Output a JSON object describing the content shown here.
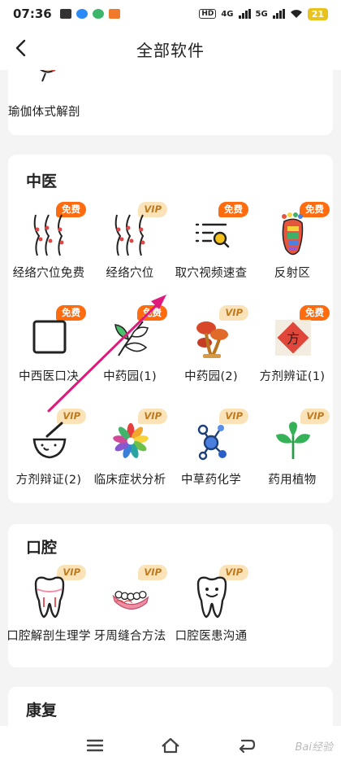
{
  "status": {
    "time": "07:36",
    "hd": "HD",
    "net1": "4G",
    "net2": "5G",
    "battery": "21"
  },
  "header": {
    "title": "全部软件"
  },
  "partial_item": {
    "label": "瑜伽体式解剖"
  },
  "sections": [
    {
      "title": "中医",
      "apps": [
        {
          "label": "经络穴位免费",
          "badge": "免费"
        },
        {
          "label": "经络穴位",
          "badge": "VIP"
        },
        {
          "label": "取穴视频速查",
          "badge": "免费"
        },
        {
          "label": "反射区",
          "badge": "免费"
        },
        {
          "label": "中西医口决",
          "badge": "免费"
        },
        {
          "label": "中药园(1)",
          "badge": "免费"
        },
        {
          "label": "中药园(2)",
          "badge": "VIP"
        },
        {
          "label": "方剂辨证(1)",
          "badge": "免费"
        },
        {
          "label": "方剂辩证(2)",
          "badge": "VIP"
        },
        {
          "label": "临床症状分析",
          "badge": "VIP"
        },
        {
          "label": "中草药化学",
          "badge": "VIP"
        },
        {
          "label": "药用植物",
          "badge": "VIP"
        }
      ]
    },
    {
      "title": "口腔",
      "apps": [
        {
          "label": "口腔解剖生理学",
          "badge": "VIP"
        },
        {
          "label": "牙周缝合方法",
          "badge": "VIP"
        },
        {
          "label": "口腔医患沟通",
          "badge": "VIP"
        }
      ]
    },
    {
      "title": "康复",
      "apps": []
    }
  ],
  "fangji_char": "方",
  "watermark": "Bai经验",
  "colors": {
    "free_badge": "#ff6b0f",
    "vip_badge_bg": "#fbe3b9",
    "vip_badge_text": "#c07a1e",
    "arrow": "#e0197d"
  }
}
